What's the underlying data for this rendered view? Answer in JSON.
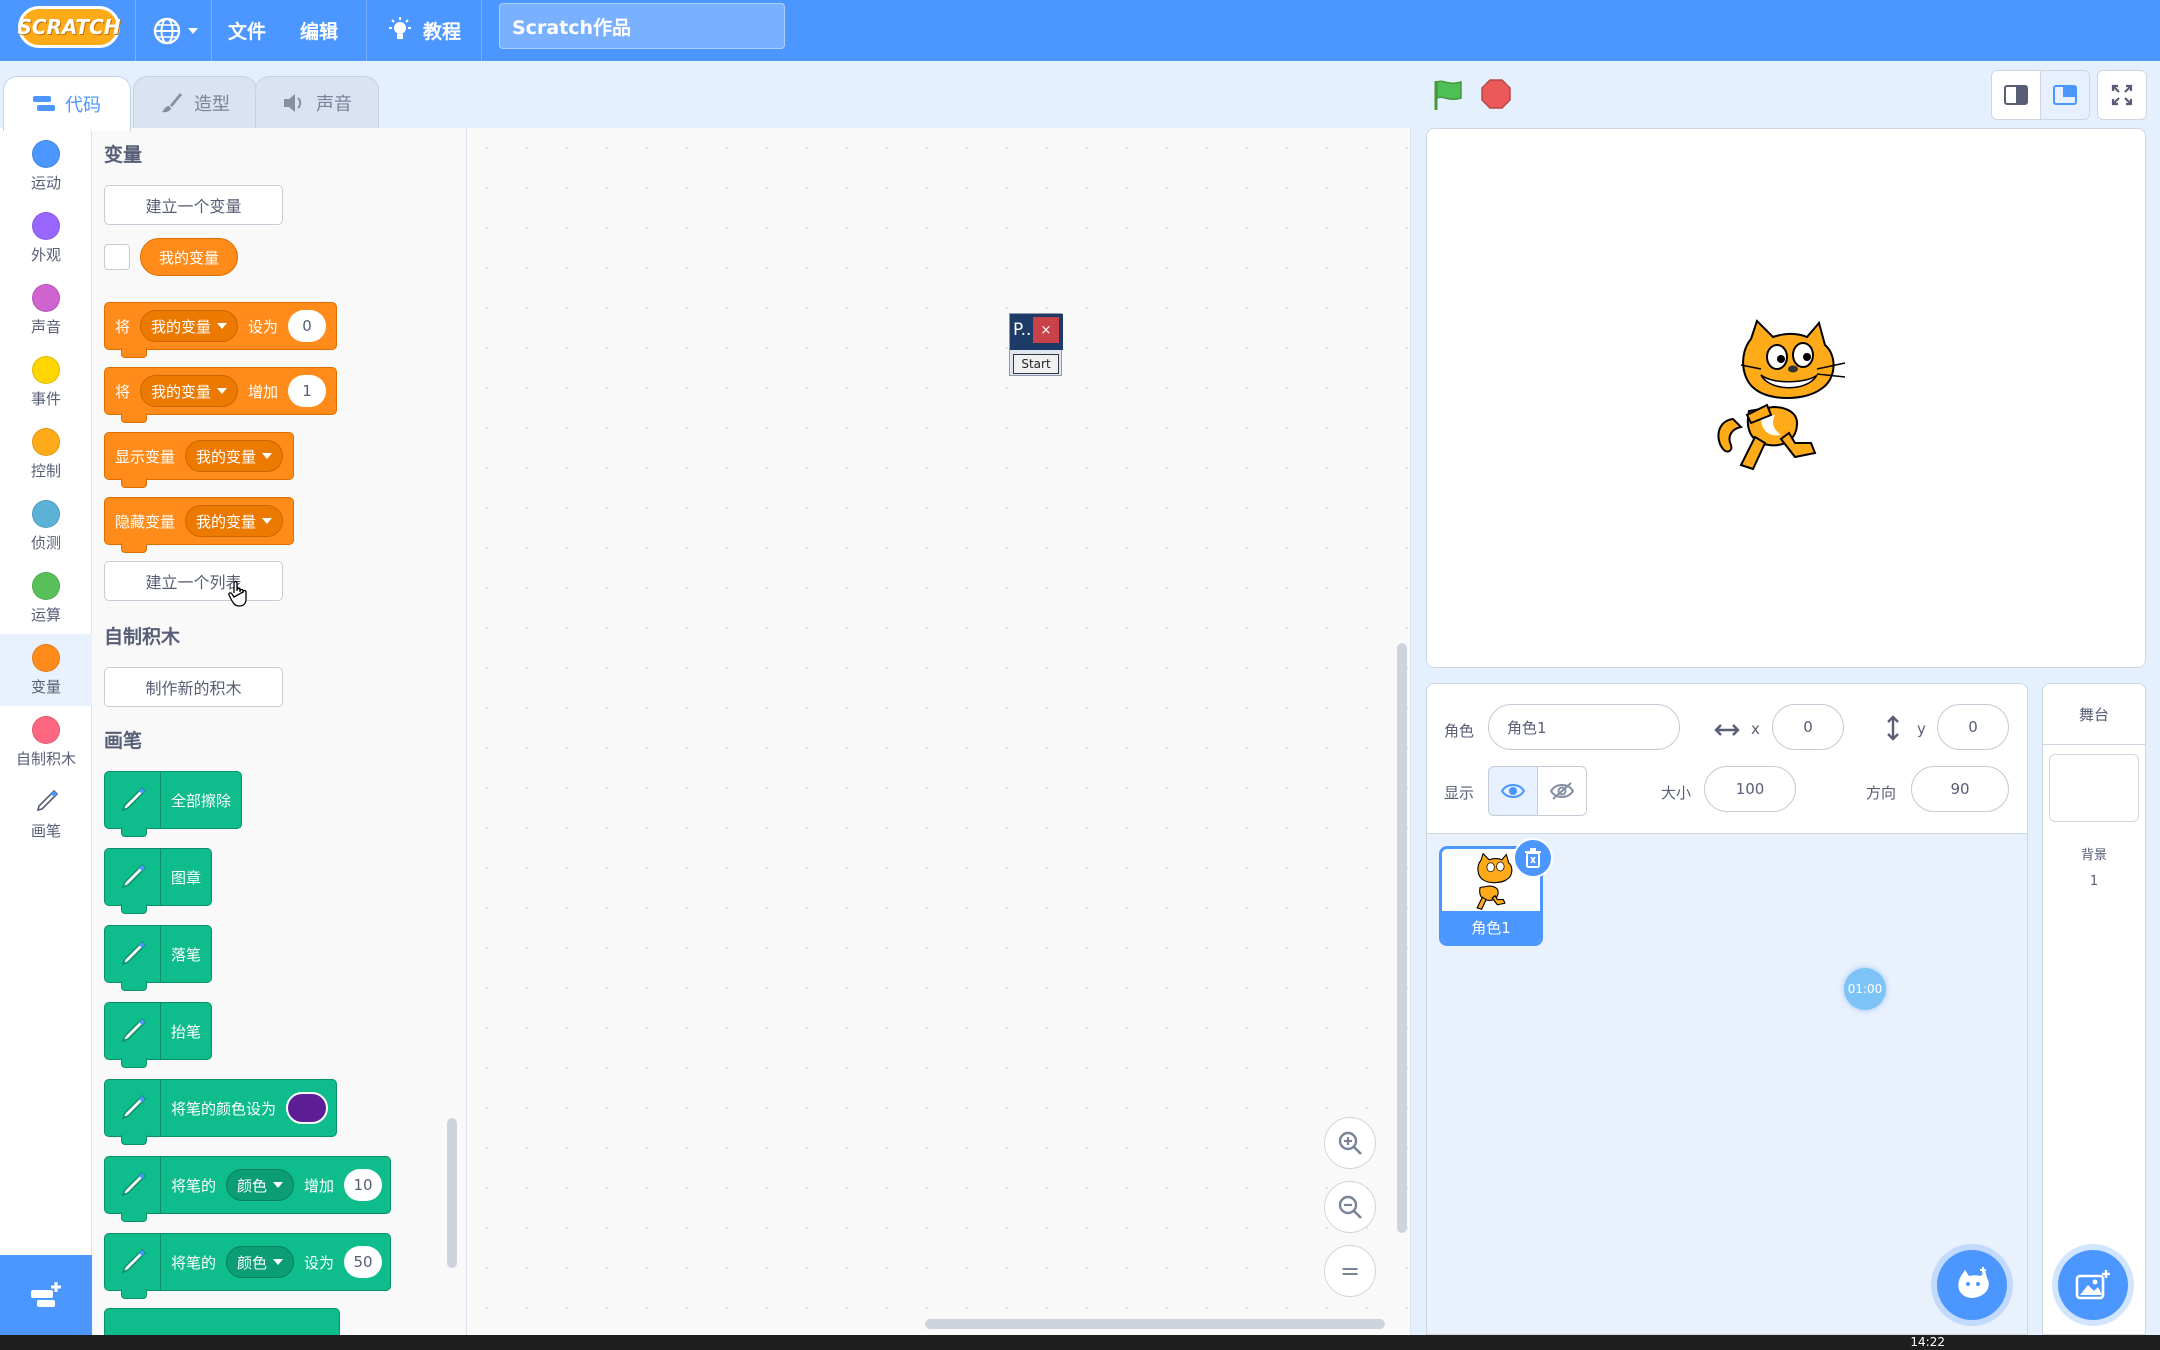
{
  "menubar": {
    "logo": "SCRATCH",
    "file": "文件",
    "edit": "编辑",
    "tutorials": "教程",
    "project_title": "Scratch作品"
  },
  "tabs": [
    {
      "label": "代码",
      "icon": "code-icon",
      "active": true
    },
    {
      "label": "造型",
      "icon": "paintbrush-icon",
      "active": false
    },
    {
      "label": "声音",
      "icon": "speaker-icon",
      "active": false
    }
  ],
  "categories": [
    {
      "label": "运动",
      "color": "#4c97ff"
    },
    {
      "label": "外观",
      "color": "#9966ff"
    },
    {
      "label": "声音",
      "color": "#cf63cf"
    },
    {
      "label": "事件",
      "color": "#ffd500"
    },
    {
      "label": "控制",
      "color": "#ffab19"
    },
    {
      "label": "侦测",
      "color": "#5cb1d6"
    },
    {
      "label": "运算",
      "color": "#59c059"
    },
    {
      "label": "变量",
      "color": "#ff8c1a"
    },
    {
      "label": "自制积木",
      "color": "#ff6680"
    },
    {
      "label": "画笔",
      "color": "#0fbd8c"
    }
  ],
  "palette": {
    "variables_title": "变量",
    "make_variable": "建立一个变量",
    "my_variable": "我的变量",
    "set_block": {
      "verb": "将",
      "var": "我的变量",
      "op": "设为",
      "value": "0"
    },
    "change_block": {
      "verb": "将",
      "var": "我的变量",
      "op": "增加",
      "value": "1"
    },
    "show_block": {
      "verb": "显示变量",
      "var": "我的变量"
    },
    "hide_block": {
      "verb": "隐藏变量",
      "var": "我的变量"
    },
    "make_list": "建立一个列表",
    "my_blocks_title": "自制积木",
    "make_block": "制作新的积木",
    "pen_title": "画笔",
    "pen_blocks": {
      "clear": "全部擦除",
      "stamp": "图章",
      "pen_down": "落笔",
      "pen_up": "抬笔",
      "set_color": "将笔的颜色设为",
      "change_param": {
        "prefix": "将笔的",
        "param": "颜色",
        "op": "增加",
        "value": "10"
      },
      "set_param": {
        "prefix": "将笔的",
        "param": "颜色",
        "op": "设为",
        "value": "50"
      }
    },
    "pen_color": "#5d1d95"
  },
  "mini_window": {
    "title": "P..",
    "close": "×",
    "button": "Start"
  },
  "zoom": {
    "in": "+",
    "out": "−",
    "reset": "="
  },
  "sprite_info": {
    "sprite_label": "角色",
    "sprite_name": "角色1",
    "x_label": "x",
    "x_value": "0",
    "y_label": "y",
    "y_value": "0",
    "show_label": "显示",
    "size_label": "大小",
    "size_value": "100",
    "direction_label": "方向",
    "direction_value": "90"
  },
  "sprites": [
    {
      "name": "角色1",
      "selected": true
    }
  ],
  "timer_badge": "01:00",
  "stage_panel": {
    "title": "舞台",
    "backdrops_label": "背景",
    "backdrops_count": "1"
  },
  "taskbar": {
    "clock": "14:22"
  },
  "colors": {
    "accent": "#4c97ff",
    "variables": "#ff8c1a",
    "pen": "#0fbd8c"
  }
}
